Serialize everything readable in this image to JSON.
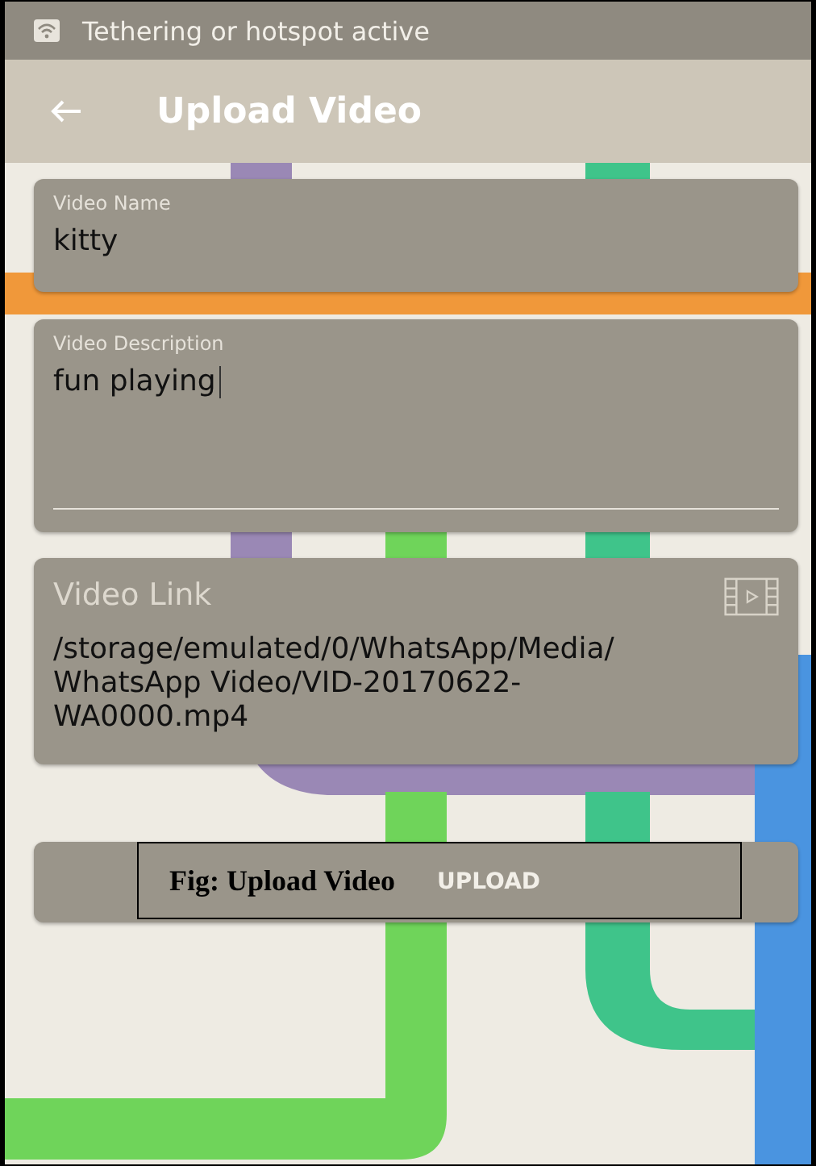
{
  "status_bar": {
    "text": "Tethering or hotspot active"
  },
  "app_bar": {
    "title": "Upload Video"
  },
  "fields": [
    {
      "kind": "text",
      "label": "Video Name",
      "value": "kitty"
    },
    {
      "kind": "multiline",
      "label": "Video Description",
      "value": "fun playing"
    },
    {
      "kind": "link",
      "label": "Video Link",
      "value": "/storage/emulated/0/WhatsApp/Media/WhatsApp Video/VID-20170622-WA0000.mp4"
    }
  ],
  "upload_button": {
    "label": "UPLOAD"
  },
  "caption": {
    "text": "Fig: Upload Video"
  }
}
